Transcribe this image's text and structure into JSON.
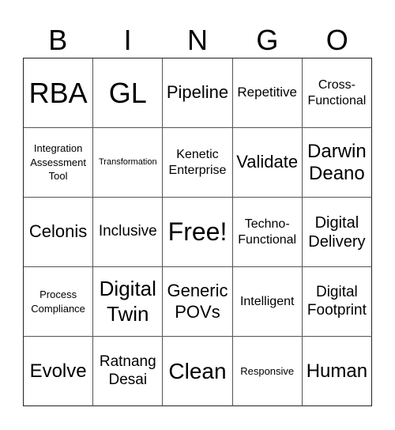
{
  "header": {
    "letters": [
      "B",
      "I",
      "N",
      "G",
      "O"
    ]
  },
  "board": {
    "cells": [
      {
        "text": "RBA",
        "size": "s36"
      },
      {
        "text": "GL",
        "size": "s36"
      },
      {
        "text": "Pipeline",
        "size": "s22"
      },
      {
        "text": "Repetitive",
        "size": "s17"
      },
      {
        "text": "Cross-\nFunctional",
        "size": "s16"
      },
      {
        "text": "Integration\nAssessment\nTool",
        "size": "s13"
      },
      {
        "text": "Transformation",
        "size": "s11"
      },
      {
        "text": "Kenetic\nEnterprise",
        "size": "s16"
      },
      {
        "text": "Validate",
        "size": "s22"
      },
      {
        "text": "Darwin\nDeano",
        "size": "s24"
      },
      {
        "text": "Celonis",
        "size": "s22"
      },
      {
        "text": "Inclusive",
        "size": "s19"
      },
      {
        "text": "Free!",
        "size": "s32"
      },
      {
        "text": "Techno-\nFunctional",
        "size": "s16"
      },
      {
        "text": "Digital\nDelivery",
        "size": "s20"
      },
      {
        "text": "Process\nCompliance",
        "size": "s13"
      },
      {
        "text": "Digital\nTwin",
        "size": "s26"
      },
      {
        "text": "Generic\nPOVs",
        "size": "s22"
      },
      {
        "text": "Intelligent",
        "size": "s16"
      },
      {
        "text": "Digital\nFootprint",
        "size": "s19"
      },
      {
        "text": "Evolve",
        "size": "s24"
      },
      {
        "text": "Ratnang\nDesai",
        "size": "s19"
      },
      {
        "text": "Clean",
        "size": "s28"
      },
      {
        "text": "Responsive",
        "size": "s13"
      },
      {
        "text": "Human",
        "size": "s24"
      }
    ]
  }
}
